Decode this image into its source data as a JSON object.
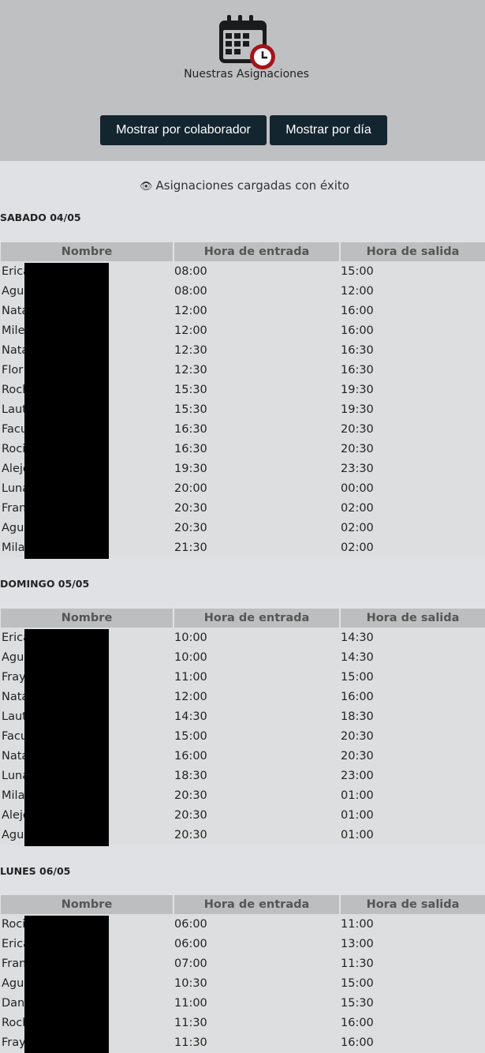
{
  "header": {
    "title": "Nuestras Asignaciones",
    "logo_icon": "calendar-clock-icon",
    "buttons": {
      "by_collaborator": "Mostrar por colaborador",
      "by_day": "Mostrar por día"
    }
  },
  "status": {
    "icon": "eye-icon",
    "text": "Asignaciones cargadas con éxito"
  },
  "columns": [
    "Nombre",
    "Hora de entrada",
    "Hora de salida"
  ],
  "days": [
    {
      "title": "SABADO 04/05",
      "rows": [
        [
          "Erica",
          "08:00",
          "15:00"
        ],
        [
          "Agu",
          "08:00",
          "12:00"
        ],
        [
          "Nata",
          "12:00",
          "16:00"
        ],
        [
          "Mile",
          "12:00",
          "16:00"
        ],
        [
          "Nata",
          "12:30",
          "16:30"
        ],
        [
          "Flor",
          "12:30",
          "16:30"
        ],
        [
          "Roch",
          "15:30",
          "19:30"
        ],
        [
          "Laut",
          "15:30",
          "19:30"
        ],
        [
          "Facu",
          "16:30",
          "20:30"
        ],
        [
          "Roci",
          "16:30",
          "20:30"
        ],
        [
          "Alejo",
          "19:30",
          "23:30"
        ],
        [
          "Luna",
          "20:00",
          "00:00"
        ],
        [
          "Fran",
          "20:30",
          "02:00"
        ],
        [
          "Agu",
          "20:30",
          "02:00"
        ],
        [
          "Mila",
          "21:30",
          "02:00"
        ]
      ]
    },
    {
      "title": "DOMINGO 05/05",
      "rows": [
        [
          "Erica",
          "10:00",
          "14:30"
        ],
        [
          "Agu",
          "10:00",
          "14:30"
        ],
        [
          "Fray",
          "11:00",
          "15:00"
        ],
        [
          "Nata",
          "12:00",
          "16:00"
        ],
        [
          "Laut",
          "14:30",
          "18:30"
        ],
        [
          "Facu",
          "15:00",
          "20:30"
        ],
        [
          "Nata",
          "16:00",
          "20:30"
        ],
        [
          "Luna",
          "18:30",
          "23:00"
        ],
        [
          "Mila",
          "20:30",
          "01:00"
        ],
        [
          "Alejo",
          "20:30",
          "01:00"
        ],
        [
          "Agu",
          "20:30",
          "01:00"
        ]
      ]
    },
    {
      "title": "LUNES 06/05",
      "rows": [
        [
          "Roci",
          "06:00",
          "11:00"
        ],
        [
          "Erica",
          "06:00",
          "13:00"
        ],
        [
          "Fran",
          "07:00",
          "11:30"
        ],
        [
          "Agu",
          "10:30",
          "15:00"
        ],
        [
          "Dani",
          "11:00",
          "15:30"
        ],
        [
          "Roch",
          "11:30",
          "16:00"
        ],
        [
          "Fray",
          "11:30",
          "16:00"
        ]
      ]
    }
  ]
}
